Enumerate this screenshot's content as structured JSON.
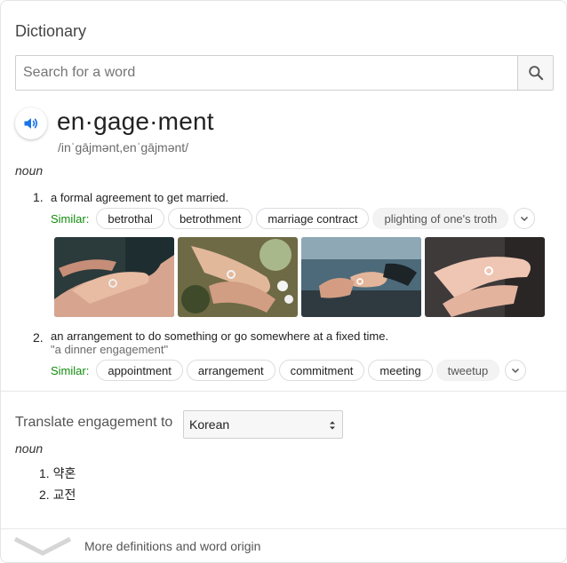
{
  "header": {
    "title": "Dictionary"
  },
  "search": {
    "placeholder": "Search for a word"
  },
  "entry": {
    "headword": "en·gage·ment",
    "phonetic": "/inˈɡājmənt,enˈɡājmənt/",
    "part_of_speech": "noun"
  },
  "definitions": [
    {
      "number": "1.",
      "text": "a formal agreement to get married.",
      "example": "",
      "similar_label": "Similar:",
      "similar": [
        "betrothal",
        "betrothment",
        "marriage contract",
        "plighting of one's troth"
      ]
    },
    {
      "number": "2.",
      "text": "an arrangement to do something or go somewhere at a fixed time.",
      "example": "\"a dinner engagement\"",
      "similar_label": "Similar:",
      "similar": [
        "appointment",
        "arrangement",
        "commitment",
        "meeting",
        "tweetup"
      ]
    }
  ],
  "images": [
    {
      "name": "engagement-image-1"
    },
    {
      "name": "engagement-image-2"
    },
    {
      "name": "engagement-image-3"
    },
    {
      "name": "engagement-image-4"
    }
  ],
  "translate": {
    "label": "Translate engagement to",
    "selected_language": "Korean",
    "part_of_speech": "noun",
    "items": [
      {
        "number": "1.",
        "text": "약혼"
      },
      {
        "number": "2.",
        "text": "교전"
      }
    ]
  },
  "footer": {
    "more_label": "More definitions and word origin"
  },
  "colors": {
    "accent_blue": "#1a73e8",
    "similar_green": "#128C0D"
  }
}
